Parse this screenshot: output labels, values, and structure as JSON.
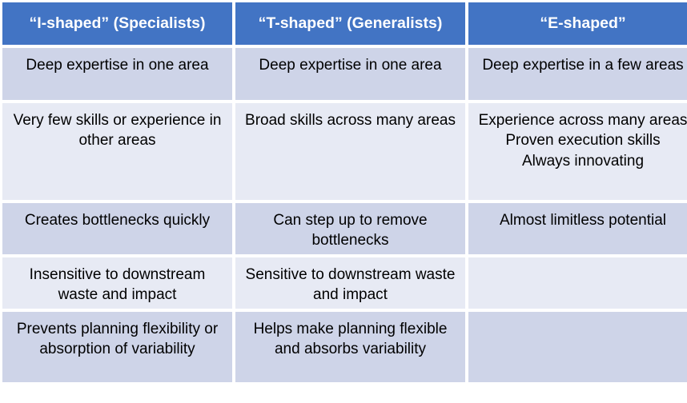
{
  "table": {
    "headers": [
      "“I-shaped”\n(Specialists)",
      "“T-shaped”\n(Generalists)",
      "“E-shaped”"
    ],
    "rows": [
      {
        "cells": [
          "Deep expertise in one area",
          "Deep expertise in one area",
          "Deep expertise in a few areas"
        ]
      },
      {
        "cells": [
          "Very few skills or experience in other areas",
          "Broad skills across many areas",
          "Experience across many areas\nProven execution skills\nAlways innovating"
        ]
      },
      {
        "cells": [
          "Creates bottlenecks quickly",
          "Can step up to remove bottlenecks",
          "Almost limitless potential"
        ]
      },
      {
        "cells": [
          "Insensitive to downstream waste and impact",
          "Sensitive to downstream waste and impact",
          ""
        ]
      },
      {
        "cells": [
          "Prevents planning flexibility or absorption of variability",
          "Helps make planning flexible and absorbs variability",
          ""
        ]
      }
    ]
  },
  "colors": {
    "header_background": "#4274c4",
    "header_text": "#ffffff",
    "band_dark": "#ced4e8",
    "band_light": "#e7eaf4",
    "cell_text": "#000000",
    "page_background": "#ffffff"
  }
}
